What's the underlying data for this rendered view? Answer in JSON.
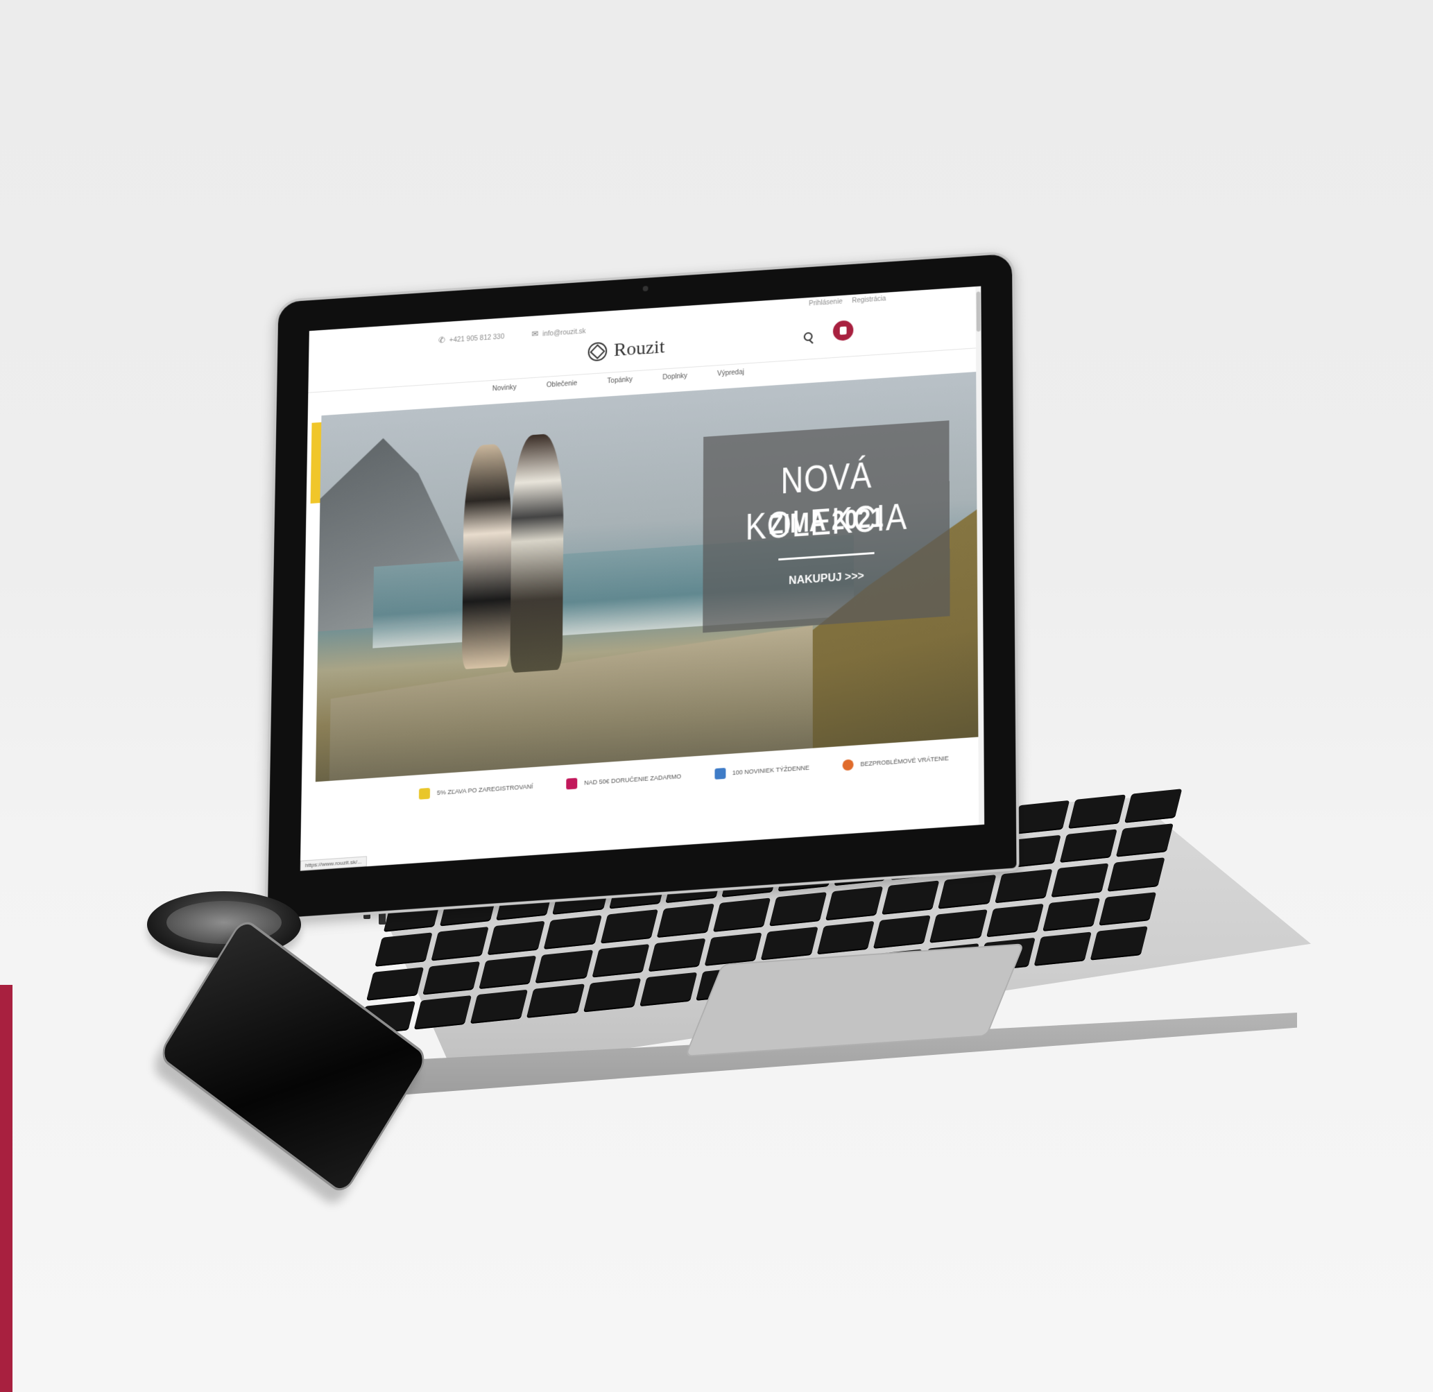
{
  "site": {
    "logo_text": "Rouzit",
    "contact_phone": "+421 905 812 330",
    "contact_email": "info@rouzit.sk",
    "top_links": [
      "Prihlásenie",
      "Registrácia"
    ],
    "nav": [
      "Novinky",
      "Oblečenie",
      "Topánky",
      "Doplnky",
      "Výpredaj"
    ],
    "hero": {
      "title": "NOVÁ KOLEKCIA",
      "subtitle": "ZIMA 2021",
      "cta": "NAKUPUJ >>>"
    },
    "features": [
      {
        "label": "5% ZĽAVA PO ZAREGISTROVANÍ",
        "icon": "tag-icon",
        "color": "#e9c62a"
      },
      {
        "label": "NAD 50€ DORUČENIE ZADARMO",
        "icon": "truck-icon",
        "color": "#c2185b"
      },
      {
        "label": "100 NOVINIEK TÝŽDENNE",
        "icon": "box-icon",
        "color": "#3f7cc7"
      },
      {
        "label": "BEZPROBLÉMOVÉ VRÁTENIE",
        "icon": "return-icon",
        "color": "#e06b2b"
      }
    ],
    "status_url": "https://www.rouzit.sk/..."
  },
  "colors": {
    "accent": "#a8203f",
    "hero_box": "#5a5a5a",
    "side_tab": "#f0c62a"
  }
}
